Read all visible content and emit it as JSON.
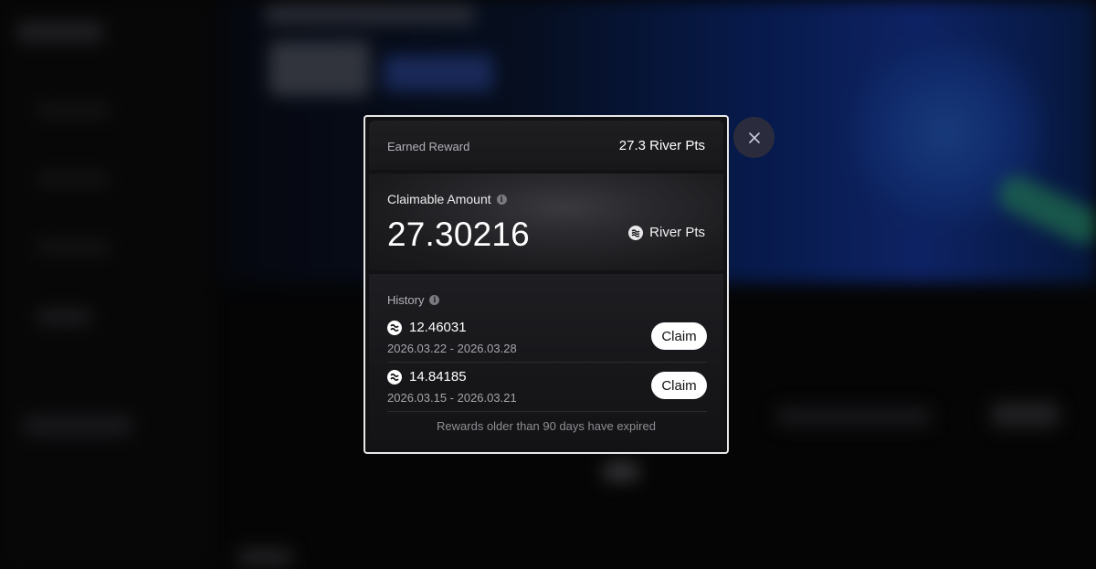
{
  "modal": {
    "earned_label": "Earned Reward",
    "earned_value": "27.3 River Pts",
    "claimable_label": "Claimable Amount",
    "claimable_amount": "27.30216",
    "token_name": "River Pts",
    "history_label": "History",
    "history": [
      {
        "amount": "12.46031",
        "date_range": "2026.03.22 - 2026.03.28",
        "button": "Claim"
      },
      {
        "amount": "14.84185",
        "date_range": "2026.03.15 - 2026.03.21",
        "button": "Claim"
      }
    ],
    "expired_note": "Rewards older than 90 days have expired",
    "info_icon": "i"
  },
  "icons": {
    "close": "close-icon",
    "token": "river-token-icon",
    "info": "info-icon"
  },
  "colors": {
    "accent": "#ffffff",
    "backdrop": "#0a0a0b",
    "close_bg": "#2a2c3d"
  }
}
